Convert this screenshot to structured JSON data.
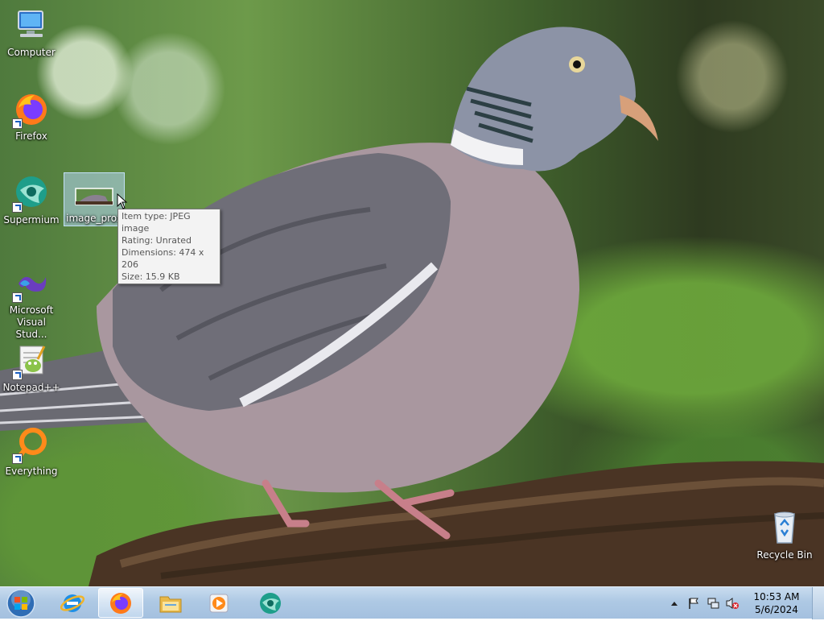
{
  "desktop": {
    "icons": [
      {
        "label": "Computer"
      },
      {
        "label": "Firefox"
      },
      {
        "label": "Supermium"
      },
      {
        "label": "image_prox"
      },
      {
        "label": "Microsoft Visual Stud..."
      },
      {
        "label": "Notepad++"
      },
      {
        "label": "Everything"
      },
      {
        "label": "Recycle Bin"
      }
    ],
    "tooltip": {
      "item_type": "Item type: JPEG image",
      "rating": "Rating: Unrated",
      "dimensions": "Dimensions: 474 x 206",
      "size": "Size: 15.9 KB"
    }
  },
  "taskbar": {
    "start_icon": "windows-orb-icon",
    "pinned": [
      {
        "icon": "internet-explorer-icon"
      },
      {
        "icon": "firefox-icon",
        "active": true
      },
      {
        "icon": "file-explorer-icon"
      },
      {
        "icon": "media-player-icon"
      },
      {
        "icon": "supermium-icon"
      }
    ],
    "tray": {
      "icons": [
        "show-hidden-icons-arrow-icon",
        "action-center-flag-icon",
        "network-icon",
        "volume-muted-icon"
      ],
      "time": "10:53 AM",
      "date": "5/6/2024"
    }
  },
  "colors": {
    "taskbar": "#aec9e4",
    "selection": "#b4d7f5",
    "tooltip_bg": "#f3f3f3"
  }
}
